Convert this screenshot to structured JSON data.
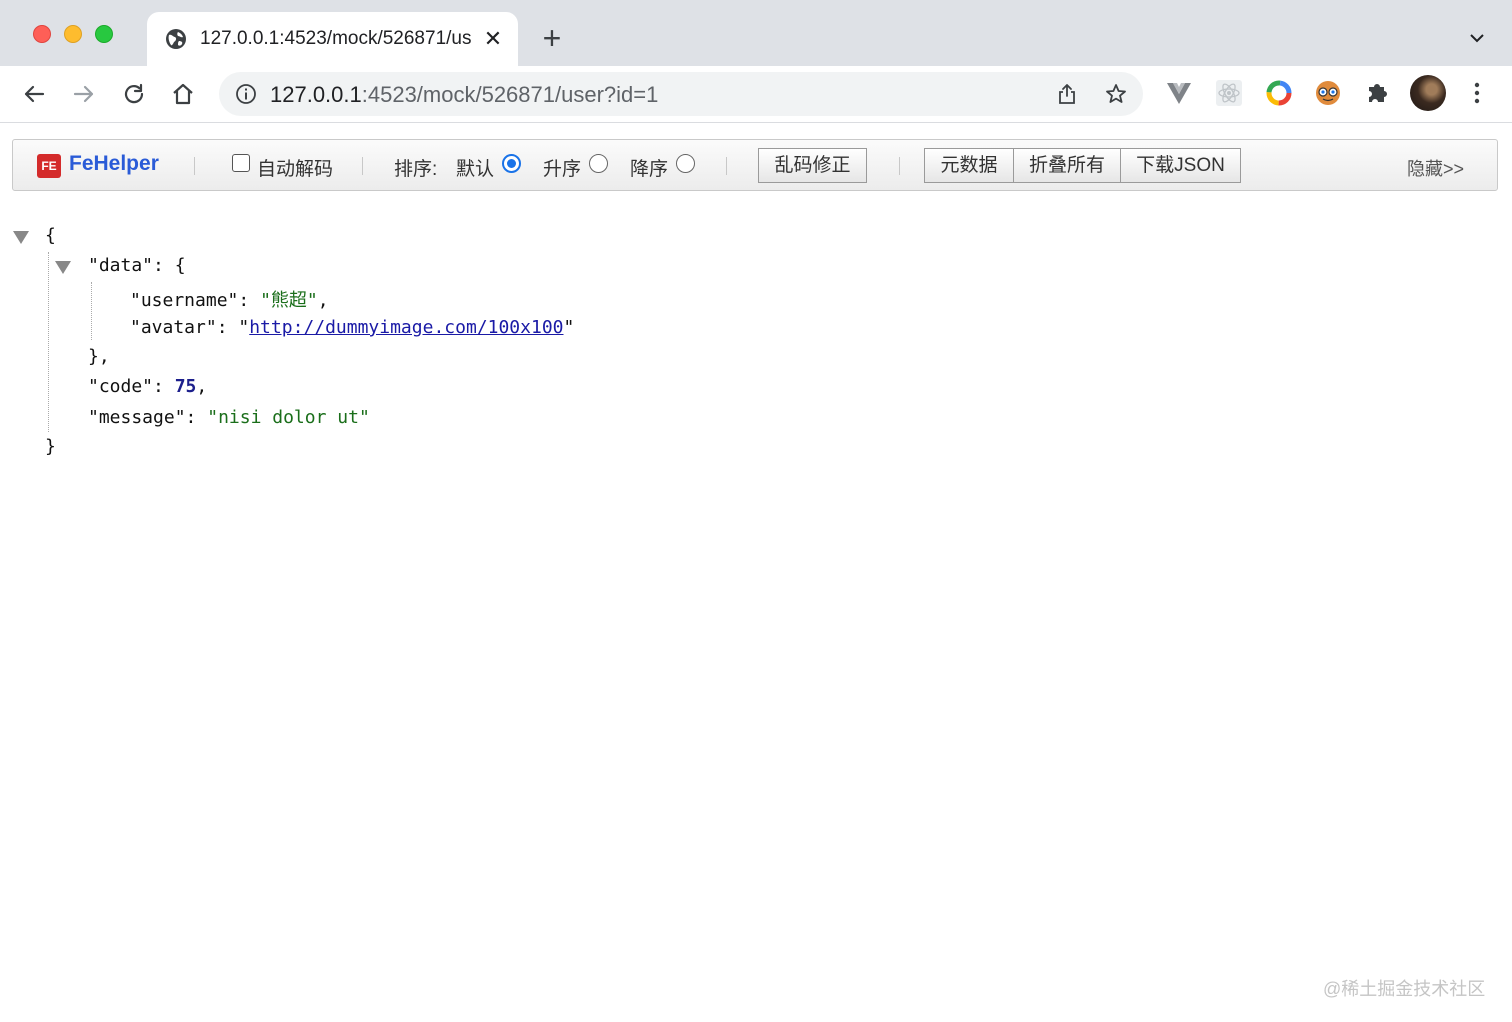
{
  "browser": {
    "tab_title": "127.0.0.1:4523/mock/526871/user?id=1",
    "url_host": "127.0.0.1",
    "url_rest": ":4523/mock/526871/user?id=1",
    "icons": {
      "tab": "globe-icon",
      "close": "close-icon",
      "new_tab": "plus-icon",
      "tab_menu": "chevron-down-icon",
      "back": "arrow-left-icon",
      "forward": "arrow-right-icon",
      "reload": "reload-icon",
      "home": "home-icon",
      "site_info": "info-icon",
      "share": "share-icon",
      "bookmark": "star-icon",
      "extensions": [
        "vue-devtools-icon",
        "react-devtools-icon",
        "color-ring-icon",
        "face-extension-icon",
        "puzzle-icon"
      ],
      "menu": "kebab-menu-icon"
    }
  },
  "fehelper": {
    "brand": "FeHelper",
    "logo_text": "FE",
    "auto_decode_label": "自动解码",
    "auto_decode_checked": false,
    "sort_label": "排序:",
    "sort_options": [
      {
        "label": "默认",
        "selected": true
      },
      {
        "label": "升序",
        "selected": false
      },
      {
        "label": "降序",
        "selected": false
      }
    ],
    "fix_encoding_button": "乱码修正",
    "metadata_button": "元数据",
    "collapse_all_button": "折叠所有",
    "download_button": "下载JSON",
    "hide_link": "隐藏>>"
  },
  "json_view": {
    "open_brace": "{",
    "close_brace": "}",
    "data_key": "\"data\"",
    "data_close": "},",
    "username_key": "\"username\"",
    "username_value": "\"熊超\"",
    "avatar_key": "\"avatar\"",
    "avatar_url": "http://dummyimage.com/100x100",
    "code_key": "\"code\"",
    "code_value": "75",
    "message_key": "\"message\"",
    "message_value": "\"nisi dolor ut\""
  },
  "watermark": "@稀土掘金技术社区",
  "colors": {
    "tabstrip": "#dee1e6",
    "brand_blue": "#2a5bd7",
    "string_green": "#1a6e1a",
    "number_navy": "#1c1f8c",
    "link_blue": "#1a1aa6",
    "radio_selected": "#1a73e8"
  }
}
